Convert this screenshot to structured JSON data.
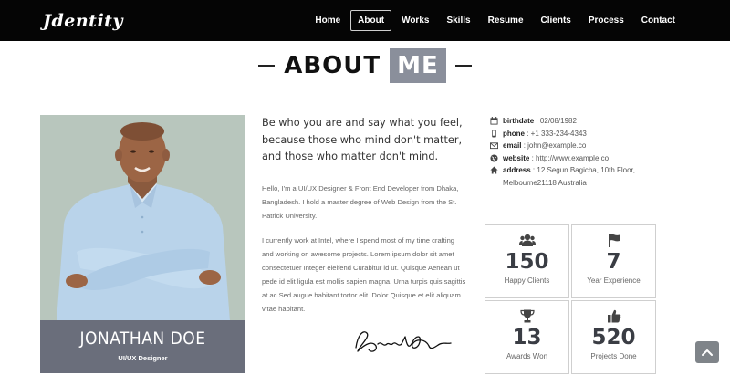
{
  "brand": {
    "name": "Jdentity"
  },
  "nav": {
    "items": [
      {
        "label": "Home",
        "active": false
      },
      {
        "label": "About",
        "active": true
      },
      {
        "label": "Works",
        "active": false
      },
      {
        "label": "Skills",
        "active": false
      },
      {
        "label": "Resume",
        "active": false
      },
      {
        "label": "Clients",
        "active": false
      },
      {
        "label": "Process",
        "active": false
      },
      {
        "label": "Contact",
        "active": false
      }
    ]
  },
  "section": {
    "title_word": "ABOUT",
    "title_highlight": "ME"
  },
  "profile": {
    "name": "JONATHAN DOE",
    "role": "UI/UX Designer"
  },
  "intro": {
    "lead": "Be who you are and say what you feel, because those who mind don't matter, and those who matter don't mind.",
    "para1": "Hello, I'm a UI/UX Designer & Front End Developer from Dhaka, Bangladesh. I hold a master degree of Web Design from the St. Patrick University.",
    "para2": "I currently work at Intel, where I spend most of my time crafting and working on awesome projects. Lorem ipsum dolor sit amet consectetuer Integer eleifend Curabitur id ut. Quisque Aenean ut pede id elit ligula est mollis sapien magna. Urna turpis quis sagittis at ac Sed augue habitant tortor elit. Dolor Quisque et elit aliquam vitae habitant."
  },
  "contact": {
    "birthdate": {
      "label": "birthdate",
      "value": ": 02/08/1982",
      "icon": "calendar-icon"
    },
    "phone": {
      "label": "phone",
      "value": ": +1 333-234-4343",
      "icon": "mobile-phone-icon"
    },
    "email": {
      "label": "email",
      "value": ": john@example.co",
      "icon": "envelope-icon"
    },
    "website": {
      "label": "website",
      "value": ": http://www.example.co",
      "icon": "globe-icon"
    },
    "address": {
      "label": "address",
      "value": ": 12 Segun Bagicha, 10th Floor, Melbourne21118 Australia",
      "icon": "home-icon"
    }
  },
  "stats": [
    {
      "value": "150",
      "label": "Happy Clients",
      "icon": "users-icon"
    },
    {
      "value": "7",
      "label": "Year Experience",
      "icon": "flag-icon"
    },
    {
      "value": "13",
      "label": "Awards Won",
      "icon": "trophy-icon"
    },
    {
      "value": "520",
      "label": "Projects Done",
      "icon": "thumbs-up-icon"
    }
  ],
  "colors": {
    "navbar": "#050505",
    "accent_gray": "#8a8f9b",
    "name_box": "#6a6e7b",
    "photo_bg": "#b8c6bd"
  }
}
